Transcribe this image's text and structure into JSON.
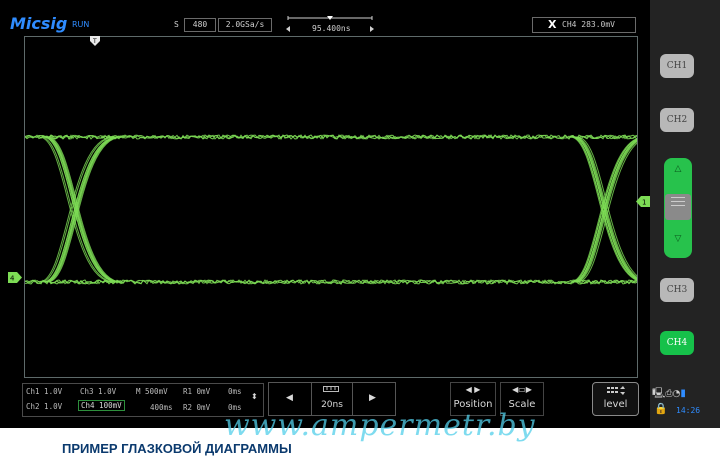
{
  "topbar": {
    "brand": "Micsig",
    "run_state": "RUN",
    "sample_mode": "S",
    "memory_depth": "480",
    "sample_rate": "2.0GSa/s",
    "time_offset": "95.400ns",
    "trigger_label": "CH4 283.0mV"
  },
  "sidebar": {
    "buttons": [
      "CH1",
      "CH2",
      "CH3",
      "CH4"
    ],
    "active": "CH4"
  },
  "channels": {
    "rows": [
      [
        "Ch1 1.0V",
        "Ch3 1.0V",
        "M 500mV",
        "R1 0mV",
        "0ms"
      ],
      [
        "Ch2 1.0V",
        "Ch4 100mV",
        "400ms",
        "R2 0mV",
        "0ms"
      ]
    ]
  },
  "controls": {
    "timebase": "20ns",
    "position_label": "Position",
    "scale_label": "Scale",
    "level_label": "level"
  },
  "status": {
    "time": "14:26"
  },
  "watermark": "www.ampermetr.by",
  "caption": "ПРИМЕР ГЛАЗКОВОЙ ДИАГРАММЫ",
  "colors": {
    "trace": "#7ddc55",
    "brand": "#2f8cff",
    "active_channel": "#16c14a",
    "caption": "#0b3a6e",
    "watermark": "#53cfea"
  }
}
